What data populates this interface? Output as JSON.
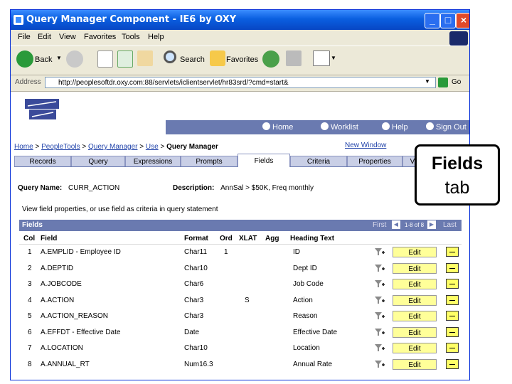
{
  "window": {
    "title": "Query Manager Component - IE6 by OXY"
  },
  "menu": [
    "File",
    "Edit",
    "View",
    "Favorites",
    "Tools",
    "Help"
  ],
  "toolbar": {
    "back": "Back",
    "search": "Search",
    "favorites": "Favorites"
  },
  "address": {
    "label": "Address",
    "url": "http://peoplesoftdr.oxy.com:88/servlets/iclientservlet/hr83srd/?cmd=start&",
    "go": "Go"
  },
  "nav": {
    "home": "Home",
    "worklist": "Worklist",
    "help": "Help",
    "signout": "Sign Out"
  },
  "breadcrumb": {
    "home": "Home",
    "sep1": ">",
    "tools": "PeopleTools",
    "sep2": ">",
    "qm": "Query Manager",
    "sep3": ">",
    "use": "Use",
    "sep4": ">",
    "current": "Query Manager"
  },
  "new_window": "New Window",
  "tabs": [
    "Records",
    "Query",
    "Expressions",
    "Prompts",
    "Fields",
    "Criteria",
    "Properties",
    "Vi"
  ],
  "query": {
    "name_label": "Query Name:",
    "name_value": "CURR_ACTION",
    "desc_label": "Description:",
    "desc_value": "AnnSal > $50K, Freq monthly"
  },
  "instructions": "View field properties, or use field as criteria in query statement",
  "grid": {
    "title": "Fields",
    "first": "First",
    "range": "1-8 of 8",
    "last": "Last",
    "columns": {
      "col": "Col",
      "field": "Field",
      "format": "Format",
      "ord": "Ord",
      "xlat": "XLAT",
      "agg": "Agg",
      "heading": "Heading Text"
    },
    "edit_label": "Edit",
    "rows": [
      {
        "col": "1",
        "field": "A.EMPLID - Employee ID",
        "format": "Char11",
        "ord": "1",
        "xlat": "",
        "agg": "",
        "heading": "ID"
      },
      {
        "col": "2",
        "field": "A.DEPTID",
        "format": "Char10",
        "ord": "",
        "xlat": "",
        "agg": "",
        "heading": "Dept ID"
      },
      {
        "col": "3",
        "field": "A.JOBCODE",
        "format": "Char6",
        "ord": "",
        "xlat": "",
        "agg": "",
        "heading": "Job Code"
      },
      {
        "col": "4",
        "field": "A.ACTION",
        "format": "Char3",
        "ord": "",
        "xlat": "S",
        "agg": "",
        "heading": "Action"
      },
      {
        "col": "5",
        "field": "A.ACTION_REASON",
        "format": "Char3",
        "ord": "",
        "xlat": "",
        "agg": "",
        "heading": "Reason"
      },
      {
        "col": "6",
        "field": "A.EFFDT - Effective Date",
        "format": "Date",
        "ord": "",
        "xlat": "",
        "agg": "",
        "heading": "Effective Date"
      },
      {
        "col": "7",
        "field": "A.LOCATION",
        "format": "Char10",
        "ord": "",
        "xlat": "",
        "agg": "",
        "heading": "Location"
      },
      {
        "col": "8",
        "field": "A.ANNUAL_RT",
        "format": "Num16.3",
        "ord": "",
        "xlat": "",
        "agg": "",
        "heading": "Annual Rate"
      }
    ]
  },
  "callout": {
    "line1": "Fields",
    "line2": "tab"
  },
  "colors": {
    "titlebar": "#0a5fe0",
    "navbar": "#6a7ab0",
    "edit_button": "#ffff99",
    "link": "#2244aa"
  }
}
